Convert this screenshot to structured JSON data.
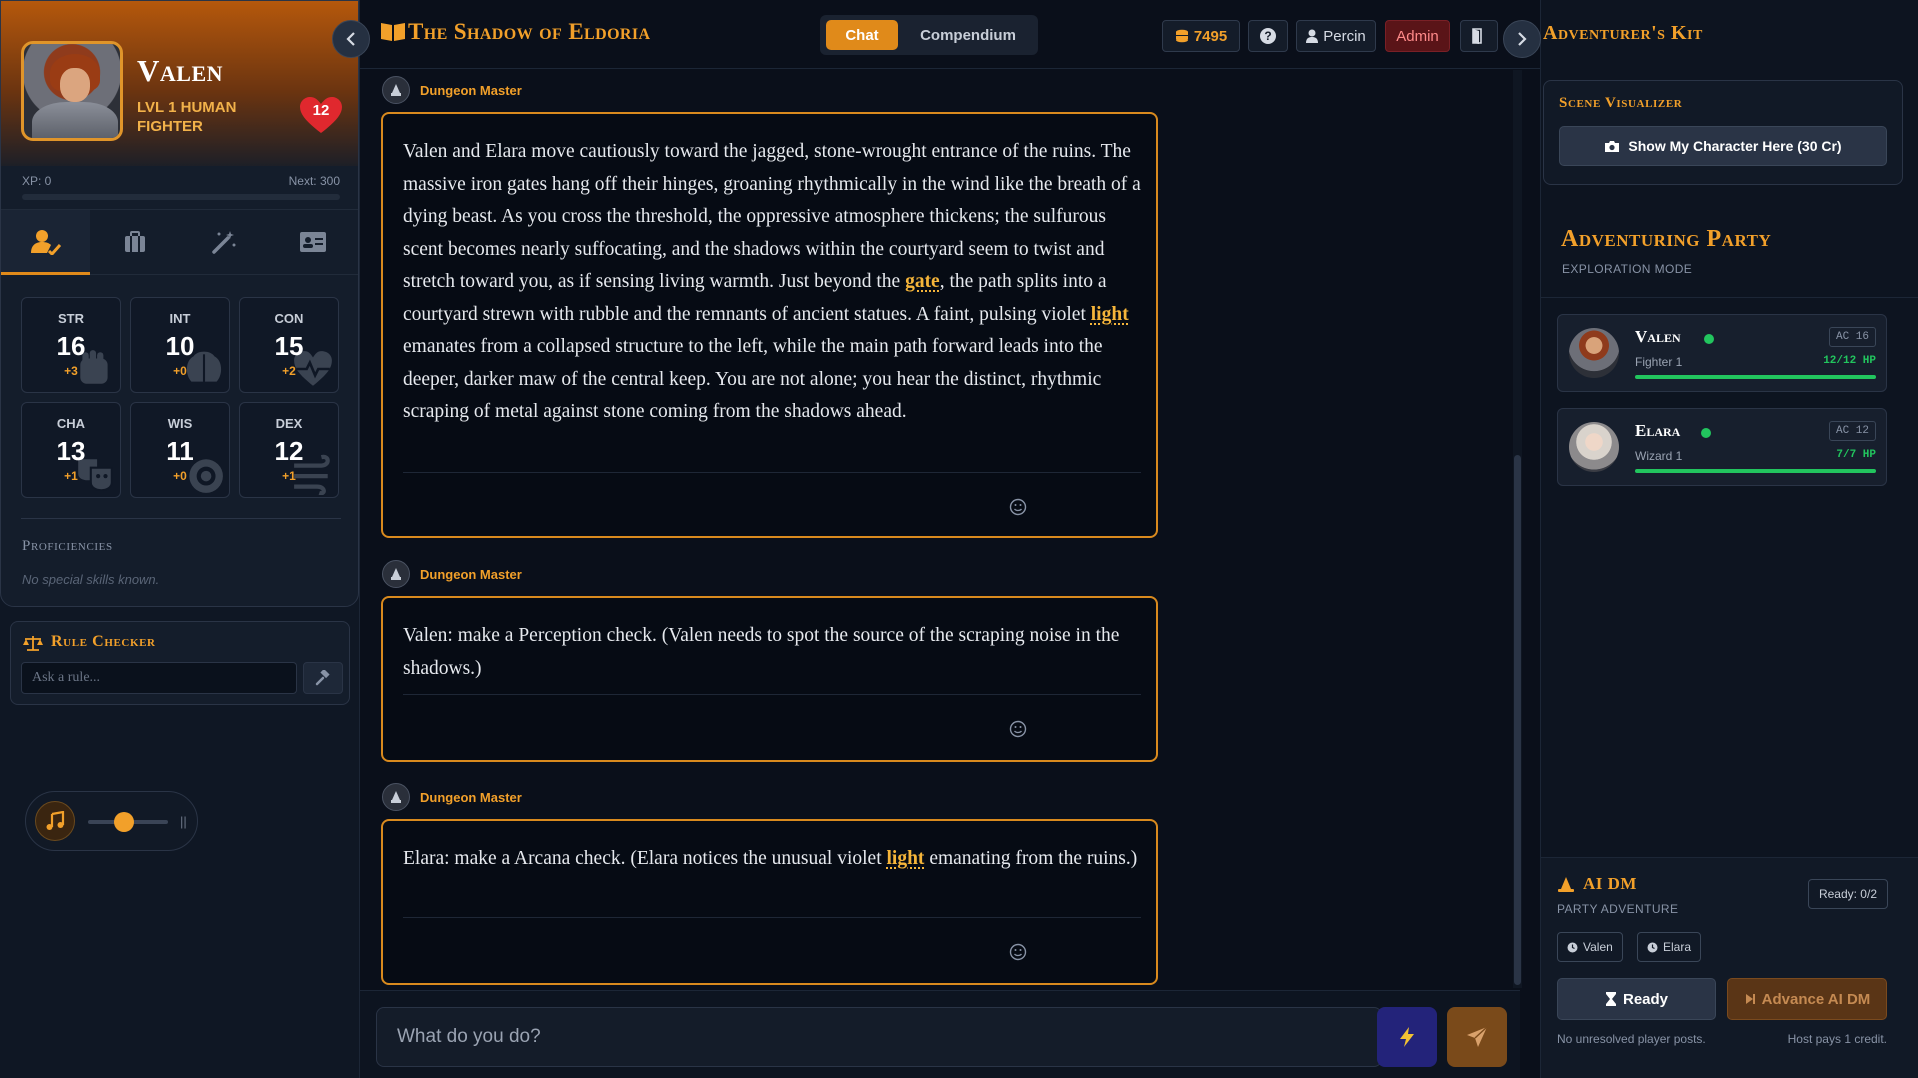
{
  "character": {
    "name": "Valen",
    "subtitle": "LVL 1 Human Fighter",
    "hp": "12",
    "xp_label": "XP: 0",
    "next_label": "Next: 300",
    "xp_progress": 0,
    "tabs": [
      "character-icon",
      "inventory-icon",
      "spells-icon",
      "id-card-icon"
    ],
    "stats": [
      {
        "label": "STR",
        "value": "16",
        "mod": "+3"
      },
      {
        "label": "INT",
        "value": "10",
        "mod": "+0"
      },
      {
        "label": "CON",
        "value": "15",
        "mod": "+2"
      },
      {
        "label": "CHA",
        "value": "13",
        "mod": "+1"
      },
      {
        "label": "WIS",
        "value": "11",
        "mod": "+0"
      },
      {
        "label": "DEX",
        "value": "12",
        "mod": "+1"
      }
    ],
    "proficiencies_title": "Proficiencies",
    "proficiencies_empty": "No special skills known."
  },
  "rule_checker": {
    "title": "Rule Checker",
    "placeholder": "Ask a rule..."
  },
  "music": {
    "volume": 0.45,
    "pause_glyph": "||"
  },
  "header": {
    "title": "The Shadow of Eldoria",
    "tabs": {
      "chat": "Chat",
      "compendium": "Compendium"
    },
    "credits": "7495",
    "help": "?",
    "user": "Percin",
    "admin": "Admin"
  },
  "chat": {
    "messages": [
      {
        "author": "Dungeon Master",
        "parts": [
          "Valen and Elara move cautiously toward the jagged, stone-wrought entrance of the ruins. The massive iron gates hang off their hinges, groaning rhythmically in the wind like the breath of a dying beast. As you cross the threshold, the oppressive atmosphere thickens; the sulfurous scent becomes nearly suffocating, and the shadows within the courtyard seem to twist and stretch toward you, as if sensing living warmth. Just beyond the ",
          "gate",
          ", the path splits into a courtyard strewn with rubble and the remnants of ancient statues. A faint, pulsing violet ",
          "light",
          " emanates from a collapsed structure to the left, while the main path forward leads into the deeper, darker maw of the central keep. You are not alone; you hear the distinct, rhythmic scraping of metal against stone coming from the shadows ahead."
        ]
      },
      {
        "author": "Dungeon Master",
        "parts": [
          "Valen: make a Perception check. (Valen needs to spot the source of the scraping noise in the shadows.)"
        ]
      },
      {
        "author": "Dungeon Master",
        "parts": [
          "Elara: make a Arcana check. (Elara notices the unusual violet ",
          "light",
          " emanating from the ruins.)"
        ]
      }
    ]
  },
  "input": {
    "placeholder": "What do you do?"
  },
  "kit": {
    "title": "Adventurer's Kit",
    "scene_title": "Scene Visualizer",
    "scene_button": "Show My Character Here (30 Cr)"
  },
  "party": {
    "title": "Adventuring Party",
    "mode": "EXPLORATION MODE",
    "members": [
      {
        "name": "Valen",
        "class": "Fighter 1",
        "ac": "AC 16",
        "hp": "12/12 HP",
        "hp_fraction": 1.0
      },
      {
        "name": "Elara",
        "class": "Wizard 1",
        "ac": "AC 12",
        "hp": "7/7 HP",
        "hp_fraction": 1.0
      }
    ]
  },
  "aidm": {
    "title": "AI DM",
    "subtitle": "PARTY ADVENTURE",
    "ready": "Ready: 0/2",
    "chips": [
      "Valen",
      "Elara"
    ],
    "ready_button": "Ready",
    "advance_button": "Advance AI DM",
    "footer_left": "No unresolved player posts.",
    "footer_right": "Host pays 1 credit."
  },
  "colors": {
    "accent": "#f2a02a",
    "accent_dark": "#e08a1a",
    "hp_green": "#22c55e",
    "heart": "#e0282e",
    "bg": "#0a0f1a"
  }
}
